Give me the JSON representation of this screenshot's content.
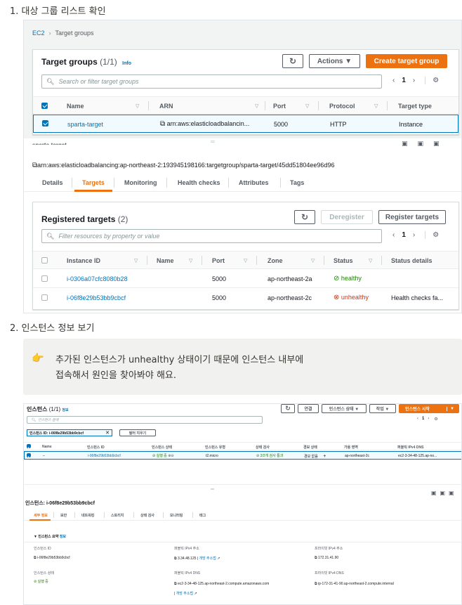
{
  "step1": {
    "title": "1.  대상 그룹 리스트 확인"
  },
  "step2": {
    "title": "2.  인스턴스 정보 보기"
  },
  "breadcrumb": {
    "root": "EC2",
    "current": "Target groups"
  },
  "target_groups": {
    "title": "Target groups",
    "count": "(1/1)",
    "info": "Info",
    "actions_label": "Actions",
    "create_label": "Create target group",
    "search_placeholder": "Search or filter target groups",
    "page": "1",
    "columns": [
      "Name",
      "ARN",
      "Port",
      "Protocol",
      "Target type"
    ],
    "row": {
      "name": "sparta-target",
      "arn": "arn:aws:elasticloadbalancin...",
      "port": "5000",
      "protocol": "HTTP",
      "target_type": "Instance"
    }
  },
  "detail": {
    "header_cut": "sparta-target",
    "arn_full": "arn:aws:elasticloadbalancing:ap-northeast-2:193945198166:targetgroup/sparta-target/45dd51804ee96d96",
    "tabs": [
      "Details",
      "Targets",
      "Monitoring",
      "Health checks",
      "Attributes",
      "Tags"
    ]
  },
  "registered": {
    "title": "Registered targets",
    "count": "(2)",
    "deregister_label": "Deregister",
    "register_label": "Register targets",
    "search_placeholder": "Filter resources by property or value",
    "page": "1",
    "columns": [
      "Instance ID",
      "Name",
      "Port",
      "Zone",
      "Status",
      "Status details"
    ],
    "rows": [
      {
        "id": "i-0306a07cfc8080b28",
        "name": "",
        "port": "5000",
        "zone": "ap-northeast-2a",
        "status": "healthy",
        "details": ""
      },
      {
        "id": "i-06f8e29b53bb9cbcf",
        "name": "",
        "port": "5000",
        "zone": "ap-northeast-2c",
        "status": "unhealthy",
        "details": "Health checks fa..."
      }
    ]
  },
  "callout": {
    "emoji": "👉",
    "line1": "추가된 인스턴스가  unhealthy 상태이기 때문에 인스턴스 내부에",
    "line2": "접속해서 원인을 찾아봐야 해요."
  },
  "instances": {
    "title": "인스턴스",
    "count": "(1/1)",
    "info": "정보",
    "connect_label": "연결",
    "state_label": "인스턴스 상태 ▼",
    "actions_label": "작업 ▼",
    "launch_label": "인스턴스 시작",
    "search_placeholder": "인스턴스 검색",
    "filter_chip": "인스턴스 ID: i-06f8e29b53bb9cbcf",
    "clear_label": "필터 지우기",
    "page": "1",
    "columns": [
      "Name",
      "인스턴스 ID",
      "인스턴스 상태",
      "인스턴스 유형",
      "상태 검사",
      "경보 상태",
      "가용 영역",
      "퍼블릭 IPv4 DNS"
    ],
    "row": {
      "name": "–",
      "id": "i-06f8e29b53bb9cbcf",
      "state": "실행 중",
      "type": "t2.micro",
      "check": "2/2개 검사 통과",
      "alarm": "경보 없음",
      "zone": "ap-northeast-2c",
      "dns": "ec2-3-34-48-125.ap-no..."
    },
    "detail_title": "인스턴스: i-06f8e29b53bb9cbcf",
    "detail_tabs": [
      "세부 정보",
      "보안",
      "네트워킹",
      "스토리지",
      "상태 검사",
      "모니터링",
      "태그"
    ],
    "summary_label": "▼ 인스턴스 요약",
    "summary_info": "정보",
    "fields": {
      "id_label": "인스턴스 ID",
      "id_value": "i-06f8e29b53bb9cbcf",
      "pub_ip_label": "퍼블릭 IPv4 주소",
      "pub_ip_value": "3.34.48.125",
      "open_addr": "개방 주소법",
      "priv_ip_label": "프라이빗 IPv4 주소",
      "priv_ip_value": "172.31.41.90",
      "state_label": "인스턴스 상태",
      "state_value": "실행 중",
      "pub_dns_label": "퍼블릭 IPv4 DNS",
      "pub_dns_value": "ec2-3-34-48-125.ap-northeast-2.compute.amazonaws.com",
      "priv_dns_label": "프라이빗 IPv4 DNS",
      "priv_dns_value": "ip-172-31-41-90.ap-northeast-2.compute.internal"
    }
  },
  "colors": {
    "accent": "#ec7211",
    "link": "#0073bb",
    "healthy": "#1d8102",
    "unhealthy": "#d13212"
  }
}
